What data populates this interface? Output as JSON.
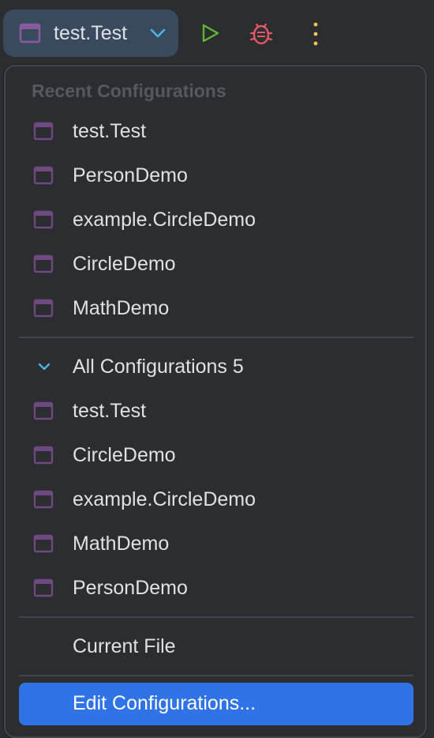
{
  "toolbar": {
    "current_config": "test.Test",
    "icons": {
      "config": "application-config-icon",
      "chevron": "chevron-down-icon",
      "run": "run-icon",
      "debug": "debug-bug-icon",
      "more": "more-vertical-icon"
    },
    "colors": {
      "widget_bg": "#3a4a5e",
      "chevron": "#4ab5e0",
      "run": "#5fb832",
      "debug": "#e55765",
      "more": "#f2c94c",
      "config_icon": "#7a4f8a"
    }
  },
  "popup": {
    "recent_title": "Recent Configurations",
    "recent": [
      {
        "label": "test.Test"
      },
      {
        "label": "PersonDemo"
      },
      {
        "label": "example.CircleDemo"
      },
      {
        "label": "CircleDemo"
      },
      {
        "label": "MathDemo"
      }
    ],
    "all_header": "All Configurations 5",
    "all": [
      {
        "label": "test.Test"
      },
      {
        "label": "CircleDemo"
      },
      {
        "label": "example.CircleDemo"
      },
      {
        "label": "MathDemo"
      },
      {
        "label": "PersonDemo"
      }
    ],
    "current_file": "Current File",
    "edit_configurations": "Edit Configurations...",
    "colors": {
      "selection": "#2f73e6"
    }
  }
}
